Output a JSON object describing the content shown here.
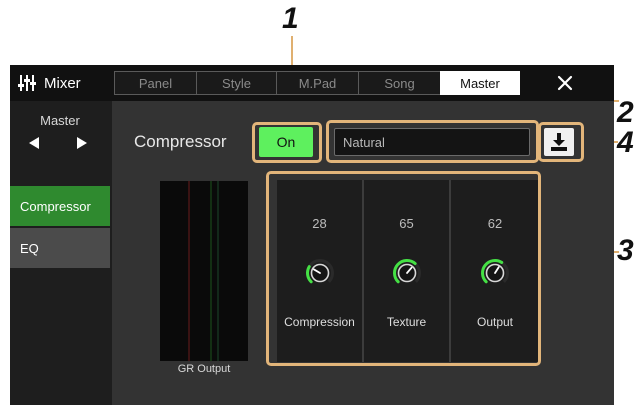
{
  "callouts": [
    "1",
    "2",
    "3",
    "4"
  ],
  "header": {
    "app_title": "Mixer",
    "tabs": [
      {
        "label": "Panel",
        "active": false
      },
      {
        "label": "Style",
        "active": false
      },
      {
        "label": "M.Pad",
        "active": false
      },
      {
        "label": "Song",
        "active": false
      },
      {
        "label": "Master",
        "active": true
      }
    ],
    "close_icon": "close-icon"
  },
  "sidebar": {
    "part_label": "Master",
    "prev_icon": "triangle-left-icon",
    "next_icon": "triangle-right-icon",
    "items": [
      {
        "label": "Compressor",
        "active": true
      },
      {
        "label": "EQ",
        "active": false
      }
    ]
  },
  "compressor": {
    "label": "Compressor",
    "on_label": "On",
    "type_value": "Natural",
    "save_icon": "save-download-icon",
    "meter_label": "GR Output",
    "knobs": [
      {
        "name": "Compression",
        "value": "28",
        "level": 0.28
      },
      {
        "name": "Texture",
        "value": "65",
        "level": 0.65
      },
      {
        "name": "Output",
        "value": "62",
        "level": 0.62
      }
    ]
  },
  "colors": {
    "accent_green": "#5ef05e",
    "active_sidebar": "#2f8a2f",
    "highlight": "#e2b57a",
    "knob_arc": "#44e044"
  }
}
